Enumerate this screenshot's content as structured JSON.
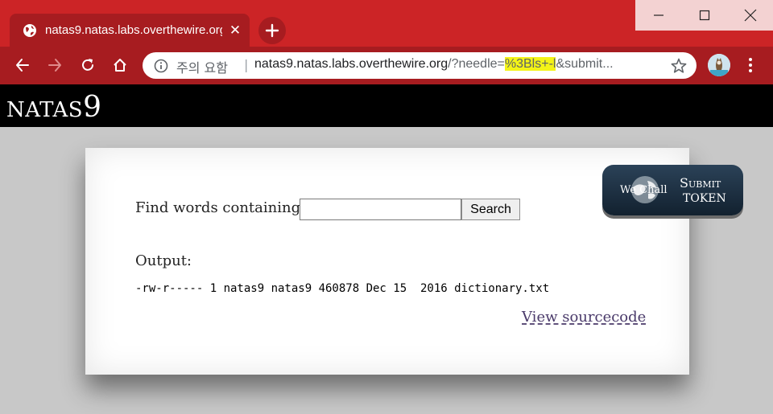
{
  "browser": {
    "tab": {
      "title": "natas9.natas.labs.overthewire.org",
      "close_symbol": "✕"
    },
    "omnibox": {
      "security_label": "주의 요함",
      "separator": "|",
      "url_host": "natas9.natas.labs.overthewire.org",
      "url_path_before": "/?needle=",
      "url_highlight": "%3Bls+-l",
      "url_path_after": "&submit..."
    },
    "icons": [
      "globe-icon",
      "close-icon",
      "plus-icon",
      "minimize-icon",
      "maximize-icon",
      "window-close-icon",
      "back-arrow-icon",
      "forward-arrow-icon",
      "reload-icon",
      "home-icon",
      "info-icon",
      "star-icon",
      "profile-avatar-icon",
      "more-vert-icon"
    ],
    "colors": {
      "frame": "#cc2426",
      "toolbar": "#a71c20",
      "url_highlight": "#f3f317"
    }
  },
  "page": {
    "header": {
      "title_prefix": "NATAS",
      "title_number": "9"
    },
    "form": {
      "find_label": "Find words containing:",
      "input_value": "",
      "search_button": "Search"
    },
    "output": {
      "label": "Output:",
      "lines": "-rw-r----- 1 natas9 natas9 460878 Dec 15  2016 dictionary.txt"
    },
    "view_source_link": "View sourcecode",
    "wechall": {
      "name": "We Chall",
      "line1": "Submit",
      "line2": "TOKEN"
    }
  }
}
